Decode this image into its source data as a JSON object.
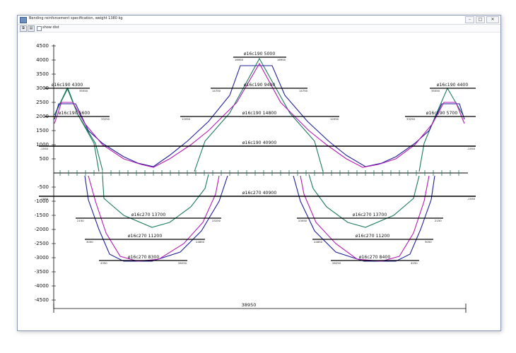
{
  "window": {
    "title": "Bending reinforcement specification, weight 1380 kg",
    "minimize": "–",
    "maximize": "□",
    "close": "✕"
  },
  "toolbar": {
    "show_dist_label": "show dist"
  },
  "icons": [
    "app-icon",
    "copy-icon",
    "print-icon"
  ],
  "colors": {
    "green": "#1b7a5c",
    "blue": "#1f1f9a",
    "magenta": "#b31ab3",
    "black": "#000000"
  },
  "y_ticks": [
    "4500",
    "4000",
    "3500",
    "3000",
    "2500",
    "2000",
    "1500",
    "1000",
    "500",
    "-500",
    "-1000",
    "-1500",
    "-2000",
    "-2500",
    "-3000",
    "-3500",
    "-4000",
    "-4500"
  ],
  "bars": [
    {
      "label": "ø16c190  5000",
      "left": "16950",
      "right": "16950"
    },
    {
      "label": "ø16c190  9400",
      "left": "14750",
      "right": "14750"
    },
    {
      "label": "ø16c190  14800",
      "left": "12050",
      "right": "12050"
    },
    {
      "label": "ø16c190  40900",
      "left": "-1550",
      "right": "-1550"
    },
    {
      "label": "ø16c190  4300",
      "left": "",
      "right": "35550"
    },
    {
      "label": "ø16c190  5600",
      "left": "",
      "right": "33250"
    },
    {
      "label": "ø16c190  4400",
      "left": "35550",
      "right": ""
    },
    {
      "label": "ø16c190  5700",
      "left": "33250",
      "right": ""
    },
    {
      "label": "ø16c270  40900",
      "left": "-1550",
      "right": "-1550"
    },
    {
      "label": "ø16c270  13700",
      "left": "2150",
      "right": "23250"
    },
    {
      "label": "ø16c270  11200",
      "left": "3050",
      "right": "24850"
    },
    {
      "label": "ø16c270  8300",
      "left": "4350",
      "right": "26250"
    },
    {
      "label": "ø16c270  13700",
      "left": "23050",
      "right": "2150"
    },
    {
      "label": "ø16c270  11200",
      "left": "24850",
      "right": "3050"
    },
    {
      "label": "ø16c270  8400",
      "left": "26250",
      "right": "4250"
    }
  ],
  "total_length": "38950"
}
